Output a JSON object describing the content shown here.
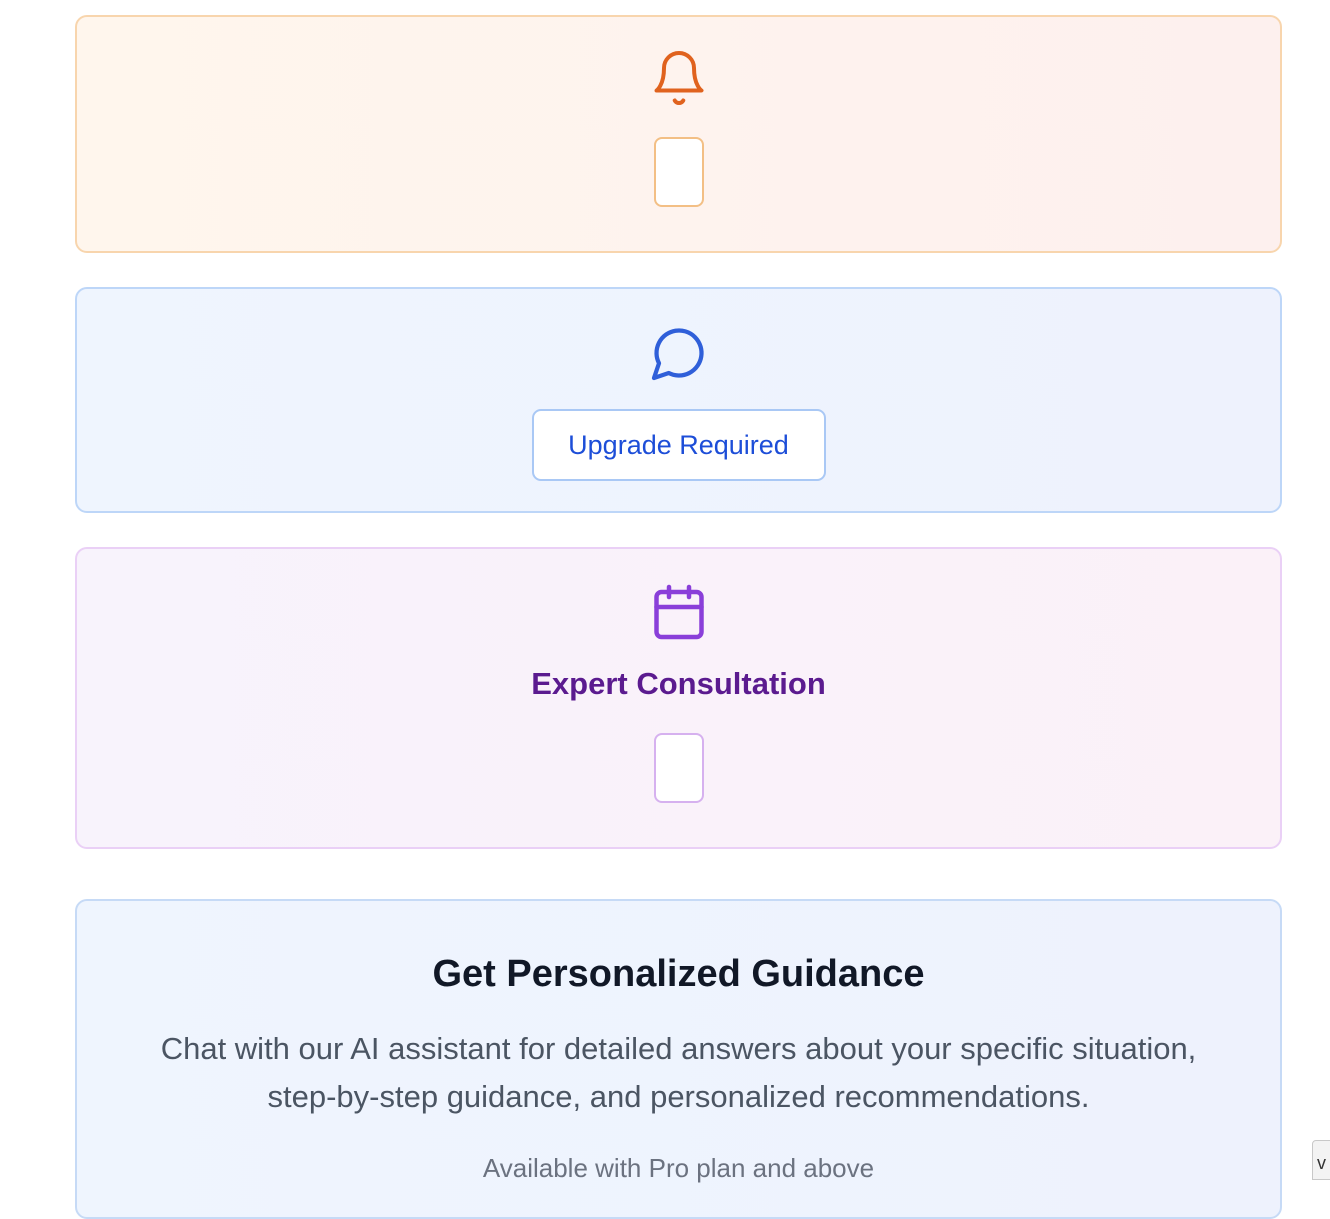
{
  "notifications_card": {
    "icon": "bell-icon",
    "accent_color": "#e0621e"
  },
  "chat_card": {
    "icon": "chat-bubble-icon",
    "accent_color": "#2f5fd9",
    "button_label": "Upgrade Required"
  },
  "consultation_card": {
    "icon": "calendar-icon",
    "accent_color": "#8a3fd9",
    "title": "Expert Consultation"
  },
  "guidance_card": {
    "title": "Get Personalized Guidance",
    "body": "Chat with our AI assistant for detailed answers about your specific situation, step-by-step guidance, and personalized recommendations.",
    "note": "Available with Pro plan and above"
  },
  "corner_widget": {
    "label": "v"
  }
}
